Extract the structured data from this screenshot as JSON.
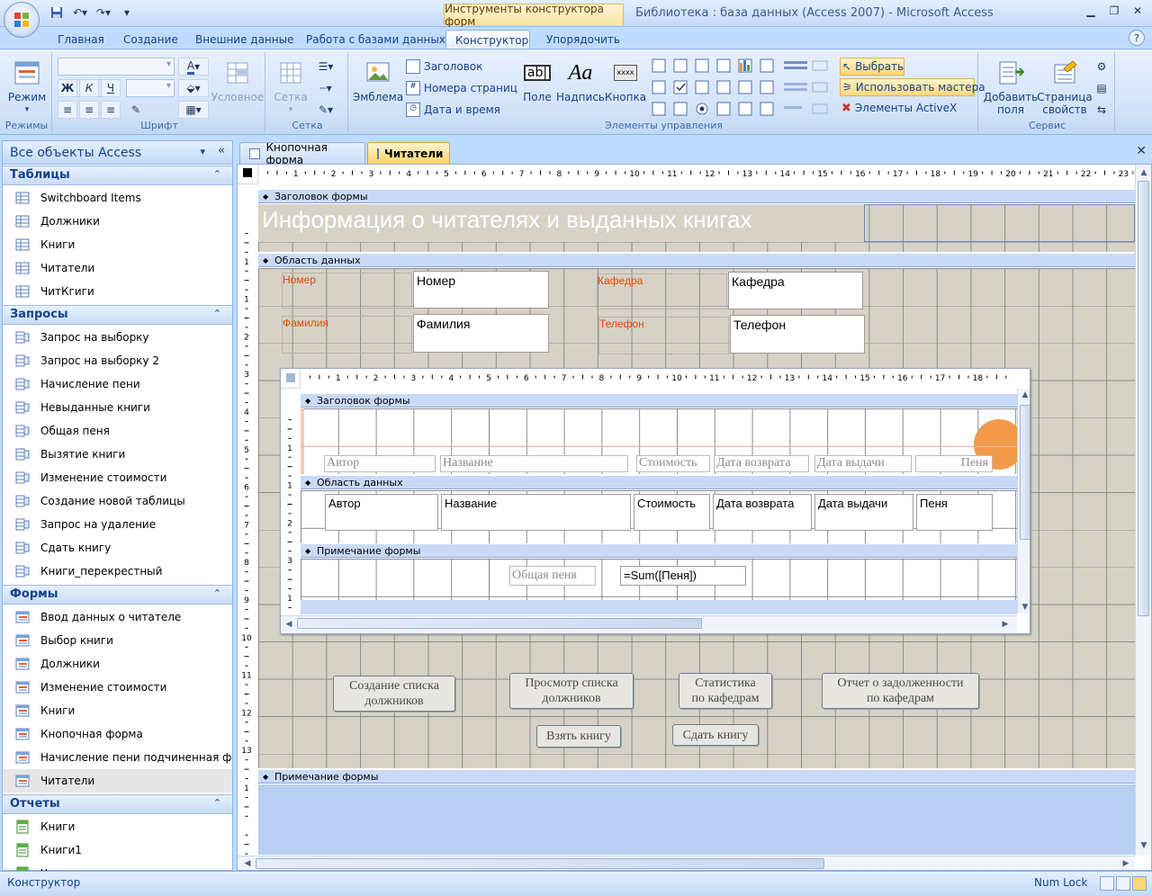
{
  "window": {
    "context_tab_title": "Инструменты конструктора форм",
    "app_title": "Библиотека : база данных (Access 2007)  -  Microsoft Access"
  },
  "ribbon_tabs": [
    "Главная",
    "Создание",
    "Внешние данные",
    "Работа с базами данных",
    "Конструктор",
    "Упорядочить"
  ],
  "ribbon": {
    "views": {
      "mode_label": "Режим",
      "caption": "Режимы"
    },
    "font": {
      "caption": "Шрифт",
      "conditional": "Условное"
    },
    "grid": {
      "label": "Сетка",
      "caption": "Сетка"
    },
    "controls": {
      "caption": "Элементы управления",
      "emblem": "Эмблема",
      "title": "Заголовок",
      "page_numbers": "Номера страниц",
      "date_time": "Дата и время",
      "field": "Поле",
      "label": "Надпись",
      "button": "Кнопка",
      "button_icon_text": "xxxx",
      "select": "Выбрать",
      "use_wizards": "Использовать мастера",
      "activex": "Элементы ActiveX"
    },
    "tools": {
      "caption": "Сервис",
      "add_fields": "Добавить\nполя",
      "property_sheet": "Страница\nсвойств"
    }
  },
  "nav": {
    "header": "Все объекты Access",
    "sections": [
      {
        "title": "Таблицы",
        "items": [
          "Switchboard Items",
          "Должники",
          "Книги",
          "Читатели",
          "ЧитКгиги"
        ]
      },
      {
        "title": "Запросы",
        "items": [
          "Запрос на выборку",
          "Запрос на выборку 2",
          "Начисление пени",
          "Невыданные книги",
          "Общая пеня",
          "Вызятие книги",
          "Изменение стоимости",
          "Создание новой таблицы",
          "Запрос на удаление",
          "Сдать книгу",
          "Книги_перекрестный"
        ]
      },
      {
        "title": "Формы",
        "items": [
          "Ввод данных о читателе",
          "Выбор книги",
          "Должники",
          "Изменение стоимости",
          "Книги",
          "Кнопочная форма",
          "Начисление пени подчиненная фо...",
          "Читатели"
        ]
      },
      {
        "title": "Отчеты",
        "items": [
          "Книги",
          "Книги1",
          "Читатели"
        ]
      }
    ],
    "selected": "Читатели"
  },
  "doc_tabs": [
    "Кнопочная форма",
    "Читатели"
  ],
  "form": {
    "header_bar": "Заголовок формы",
    "title": "Информация о читателях и выданных книгах",
    "detail_bar": "Область данных",
    "footer_bar": "Примечание формы",
    "labels": {
      "nomer": "Номер",
      "familiya": "Фамилия",
      "kafedra": "Кафедра",
      "telefon": "Телефон"
    },
    "fields": {
      "nomer": "Номер",
      "familiya": "Фамилия",
      "kafedra": "Кафедра",
      "telefon": "Телефон"
    },
    "subform": {
      "header_bar": "Заголовок формы",
      "detail_bar": "Область данных",
      "footer_bar": "Примечание формы",
      "header_labels": [
        "Автор",
        "Название",
        "Стоимость",
        "Дата возврата",
        "Дата выдачи",
        "Пеня"
      ],
      "fields": [
        "Автор",
        "Название",
        "Стоимость",
        "Дата возврата",
        "Дата выдачи",
        "Пеня"
      ],
      "total_label": "Общая пеня",
      "total_expr": "=Sum([Пеня])"
    },
    "buttons": {
      "create_debtors": "Создание списка\nдолжников",
      "view_debtors": "Просмотр списка\nдолжников",
      "stats": "Статистика\nпо кафедрам",
      "debt_report": "Отчет о задолженности\nпо кафедрам",
      "take_book": "Взять книгу",
      "return_book": "Сдать книгу"
    }
  },
  "ruler_main": [
    "1",
    "2",
    "3",
    "4",
    "5",
    "6",
    "7",
    "8",
    "9",
    "10",
    "11",
    "12",
    "13",
    "14",
    "15",
    "16",
    "17",
    "18",
    "19",
    "20",
    "21",
    "22",
    "23"
  ],
  "ruler_main_v": [
    "1",
    "1",
    "2",
    "3",
    "4",
    "5",
    "6",
    "7",
    "8",
    "9",
    "10",
    "11",
    "12",
    "13",
    "1"
  ],
  "ruler_sub": [
    "1",
    "2",
    "3",
    "4",
    "5",
    "6",
    "7",
    "8",
    "9",
    "10",
    "11",
    "12",
    "13",
    "14",
    "15",
    "16",
    "17",
    "18"
  ],
  "ruler_sub_v": [
    "1",
    "1",
    "2",
    "3",
    "1"
  ],
  "status": {
    "mode": "Конструктор",
    "numlock": "Num Lock"
  },
  "colors": {
    "accent": "#15428b",
    "label_red": "#e24b00",
    "title_bg": "#d7d2c6"
  }
}
